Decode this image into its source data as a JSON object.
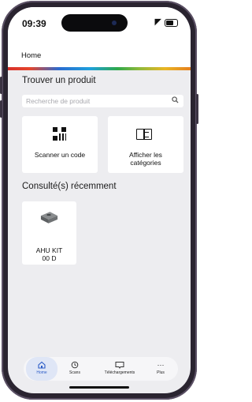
{
  "status_bar": {
    "time": "09:39"
  },
  "header": {
    "title": "Home"
  },
  "find_product": {
    "title": "Trouver un produit",
    "search_placeholder": "Recherche de produit"
  },
  "actions": {
    "scan_label": "Scanner un code",
    "categories_label_line1": "Afficher les",
    "categories_label_line2": "catégories"
  },
  "recent": {
    "title": "Consulté(s) récemment",
    "items": [
      {
        "name_line1": "AHU KIT",
        "name_line2": "00 D"
      }
    ]
  },
  "tabbar": {
    "active": "home",
    "items": [
      {
        "key": "home",
        "label": "Home",
        "icon": "home-icon"
      },
      {
        "key": "scans",
        "label": "Scans",
        "icon": "history-icon"
      },
      {
        "key": "downloads",
        "label": "Téléchargements",
        "icon": "downloads-icon"
      },
      {
        "key": "more",
        "label": "Plus",
        "icon": "more-icon"
      }
    ]
  },
  "colors": {
    "accent": "#2c5cc7",
    "background": "#ededf0",
    "rainbow": [
      "#d9312b",
      "#2a6bd0",
      "#1ea0dc",
      "#2ea84a",
      "#e9b524",
      "#e57f1d"
    ]
  }
}
